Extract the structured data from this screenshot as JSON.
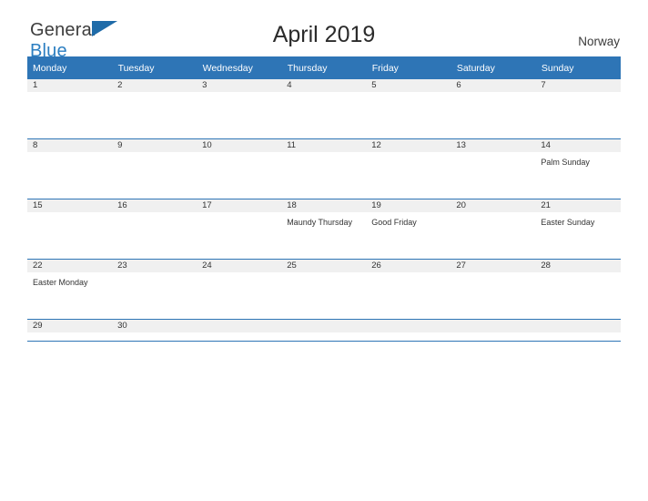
{
  "brand": {
    "name_top": "General",
    "name_bottom": "Blue",
    "flag_icon": "flag-icon"
  },
  "header": {
    "title": "April 2019",
    "country": "Norway"
  },
  "calendar": {
    "weekday_headers": [
      "Monday",
      "Tuesday",
      "Wednesday",
      "Thursday",
      "Friday",
      "Saturday",
      "Sunday"
    ],
    "accent_color": "#2e75b6",
    "daynum_bg": "#f0f0f0",
    "weeks": [
      [
        {
          "day": "1",
          "event": ""
        },
        {
          "day": "2",
          "event": ""
        },
        {
          "day": "3",
          "event": ""
        },
        {
          "day": "4",
          "event": ""
        },
        {
          "day": "5",
          "event": ""
        },
        {
          "day": "6",
          "event": ""
        },
        {
          "day": "7",
          "event": ""
        }
      ],
      [
        {
          "day": "8",
          "event": ""
        },
        {
          "day": "9",
          "event": ""
        },
        {
          "day": "10",
          "event": ""
        },
        {
          "day": "11",
          "event": ""
        },
        {
          "day": "12",
          "event": ""
        },
        {
          "day": "13",
          "event": ""
        },
        {
          "day": "14",
          "event": "Palm Sunday"
        }
      ],
      [
        {
          "day": "15",
          "event": ""
        },
        {
          "day": "16",
          "event": ""
        },
        {
          "day": "17",
          "event": ""
        },
        {
          "day": "18",
          "event": "Maundy Thursday"
        },
        {
          "day": "19",
          "event": "Good Friday"
        },
        {
          "day": "20",
          "event": ""
        },
        {
          "day": "21",
          "event": "Easter Sunday"
        }
      ],
      [
        {
          "day": "22",
          "event": "Easter Monday"
        },
        {
          "day": "23",
          "event": ""
        },
        {
          "day": "24",
          "event": ""
        },
        {
          "day": "25",
          "event": ""
        },
        {
          "day": "26",
          "event": ""
        },
        {
          "day": "27",
          "event": ""
        },
        {
          "day": "28",
          "event": ""
        }
      ],
      [
        {
          "day": "29",
          "event": ""
        },
        {
          "day": "30",
          "event": ""
        },
        {
          "day": "",
          "event": ""
        },
        {
          "day": "",
          "event": ""
        },
        {
          "day": "",
          "event": ""
        },
        {
          "day": "",
          "event": ""
        },
        {
          "day": "",
          "event": ""
        }
      ]
    ]
  }
}
